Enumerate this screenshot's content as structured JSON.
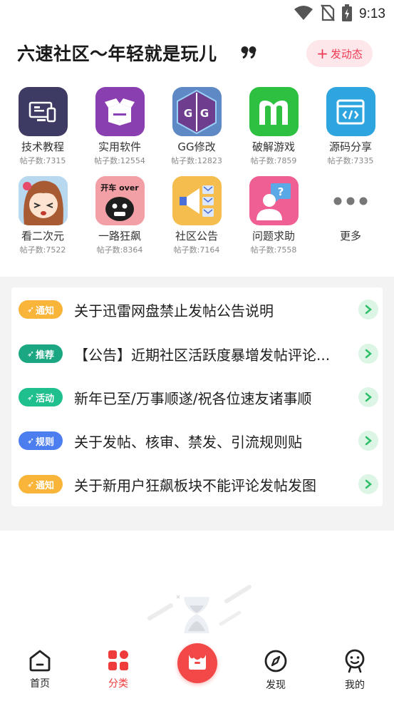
{
  "status_bar": {
    "time": "9:13"
  },
  "header": {
    "title": "六速社区～年轻就是玩儿",
    "post_button": "发动态"
  },
  "categories": [
    {
      "label": "技术教程",
      "count": "帖子数:7315",
      "icon": "computer-icon",
      "color": "#3d3b63"
    },
    {
      "label": "实用软件",
      "count": "帖子数:12554",
      "icon": "box-icon",
      "color": "#8a3fb0"
    },
    {
      "label": "GG修改",
      "count": "帖子数:12823",
      "icon": "gg-icon",
      "color": "#5f89c4"
    },
    {
      "label": "破解游戏",
      "count": "帖子数:7859",
      "icon": "m-game-icon",
      "color": "#2dc041"
    },
    {
      "label": "源码分享",
      "count": "帖子数:7335",
      "icon": "code-icon",
      "color": "#2fa5e0"
    },
    {
      "label": "看二次元",
      "count": "帖子数:7522",
      "icon": "anime-icon",
      "color": "#9fc7e8"
    },
    {
      "label": "一路狂飙",
      "count": "帖子数:8364",
      "icon": "meme-icon",
      "color": "#f2a0a6",
      "icon_text": "开车 over"
    },
    {
      "label": "社区公告",
      "count": "帖子数:7164",
      "icon": "megaphone-icon",
      "color": "#f4bd4d"
    },
    {
      "label": "问题求助",
      "count": "帖子数:7558",
      "icon": "help-icon",
      "color": "#ef5f93"
    },
    {
      "label": "更多",
      "count": "",
      "icon": "more-dots-icon",
      "color": "#ffffff"
    }
  ],
  "notices": [
    {
      "tag": "通知",
      "tag_color": "#f8b53a",
      "text": "关于迅雷网盘禁止发帖公告说明"
    },
    {
      "tag": "推荐",
      "tag_color": "#1ca783",
      "text": "【公告】近期社区活跃度暴增发帖评论..."
    },
    {
      "tag": "活动",
      "tag_color": "#1fbf8e",
      "text": "新年已至/万事顺遂/祝各位速友诸事顺"
    },
    {
      "tag": "规则",
      "tag_color": "#4d7ef0",
      "text": "关于发帖、核审、禁发、引流规则贴"
    },
    {
      "tag": "通知",
      "tag_color": "#f8b53a",
      "text": "关于新用户狂飙板块不能评论发帖发图"
    }
  ],
  "bottom_nav": [
    {
      "label": "首页",
      "icon": "home-icon"
    },
    {
      "label": "分类",
      "icon": "category-grid-icon",
      "active": true
    },
    {
      "label": "",
      "icon": "shop-icon"
    },
    {
      "label": "发现",
      "icon": "compass-icon"
    },
    {
      "label": "我的",
      "icon": "profile-icon"
    }
  ],
  "colors": {
    "accent": "#ef3b3b",
    "post_button_bg": "#fde7ea",
    "arrow_bg": "#dcf5e4",
    "arrow_fg": "#2fbf6a"
  }
}
